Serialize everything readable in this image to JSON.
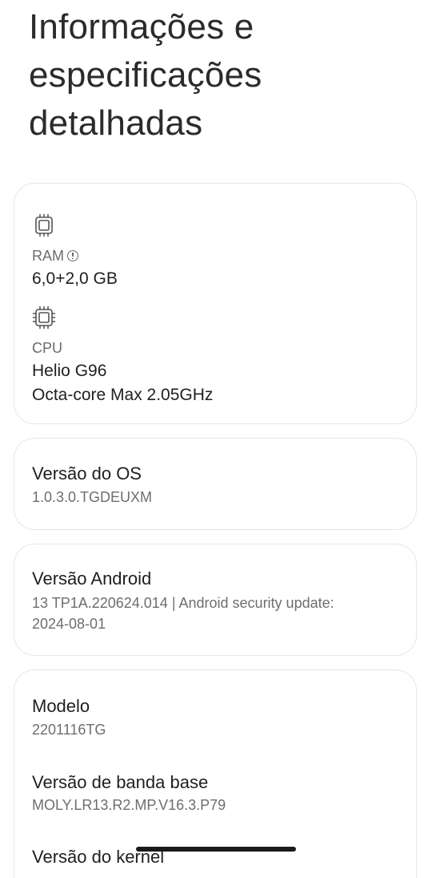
{
  "page": {
    "title": "Informações e\nespecificações\ndetalhadas"
  },
  "hardware": {
    "ram": {
      "icon": "memory-chip-icon",
      "label": "RAM",
      "info_icon": "info-icon",
      "value": "6,0+2,0 GB"
    },
    "cpu": {
      "icon": "processor-chip-icon",
      "label": "CPU",
      "value_line1": "Helio G96",
      "value_line2": "Octa-core Max 2.05GHz"
    }
  },
  "os_version": {
    "title": "Versão do OS",
    "value": "1.0.3.0.TGDEUXM"
  },
  "android_version": {
    "title": "Versão Android",
    "value_line1": "13 TP1A.220624.014 | Android security update:",
    "value_line2": "2024-08-01"
  },
  "device": {
    "model_title": "Modelo",
    "model_value": "2201116TG",
    "baseband_title": "Versão de banda base",
    "baseband_value": "MOLY.LR13.R2.MP.V16.3.P79",
    "kernel_title": "Versão do kernel"
  },
  "colors": {
    "background": "#ffffff",
    "card_border": "#e6e6e6",
    "primary_text": "#1f1f1f",
    "secondary_text": "#6e6e6e"
  }
}
